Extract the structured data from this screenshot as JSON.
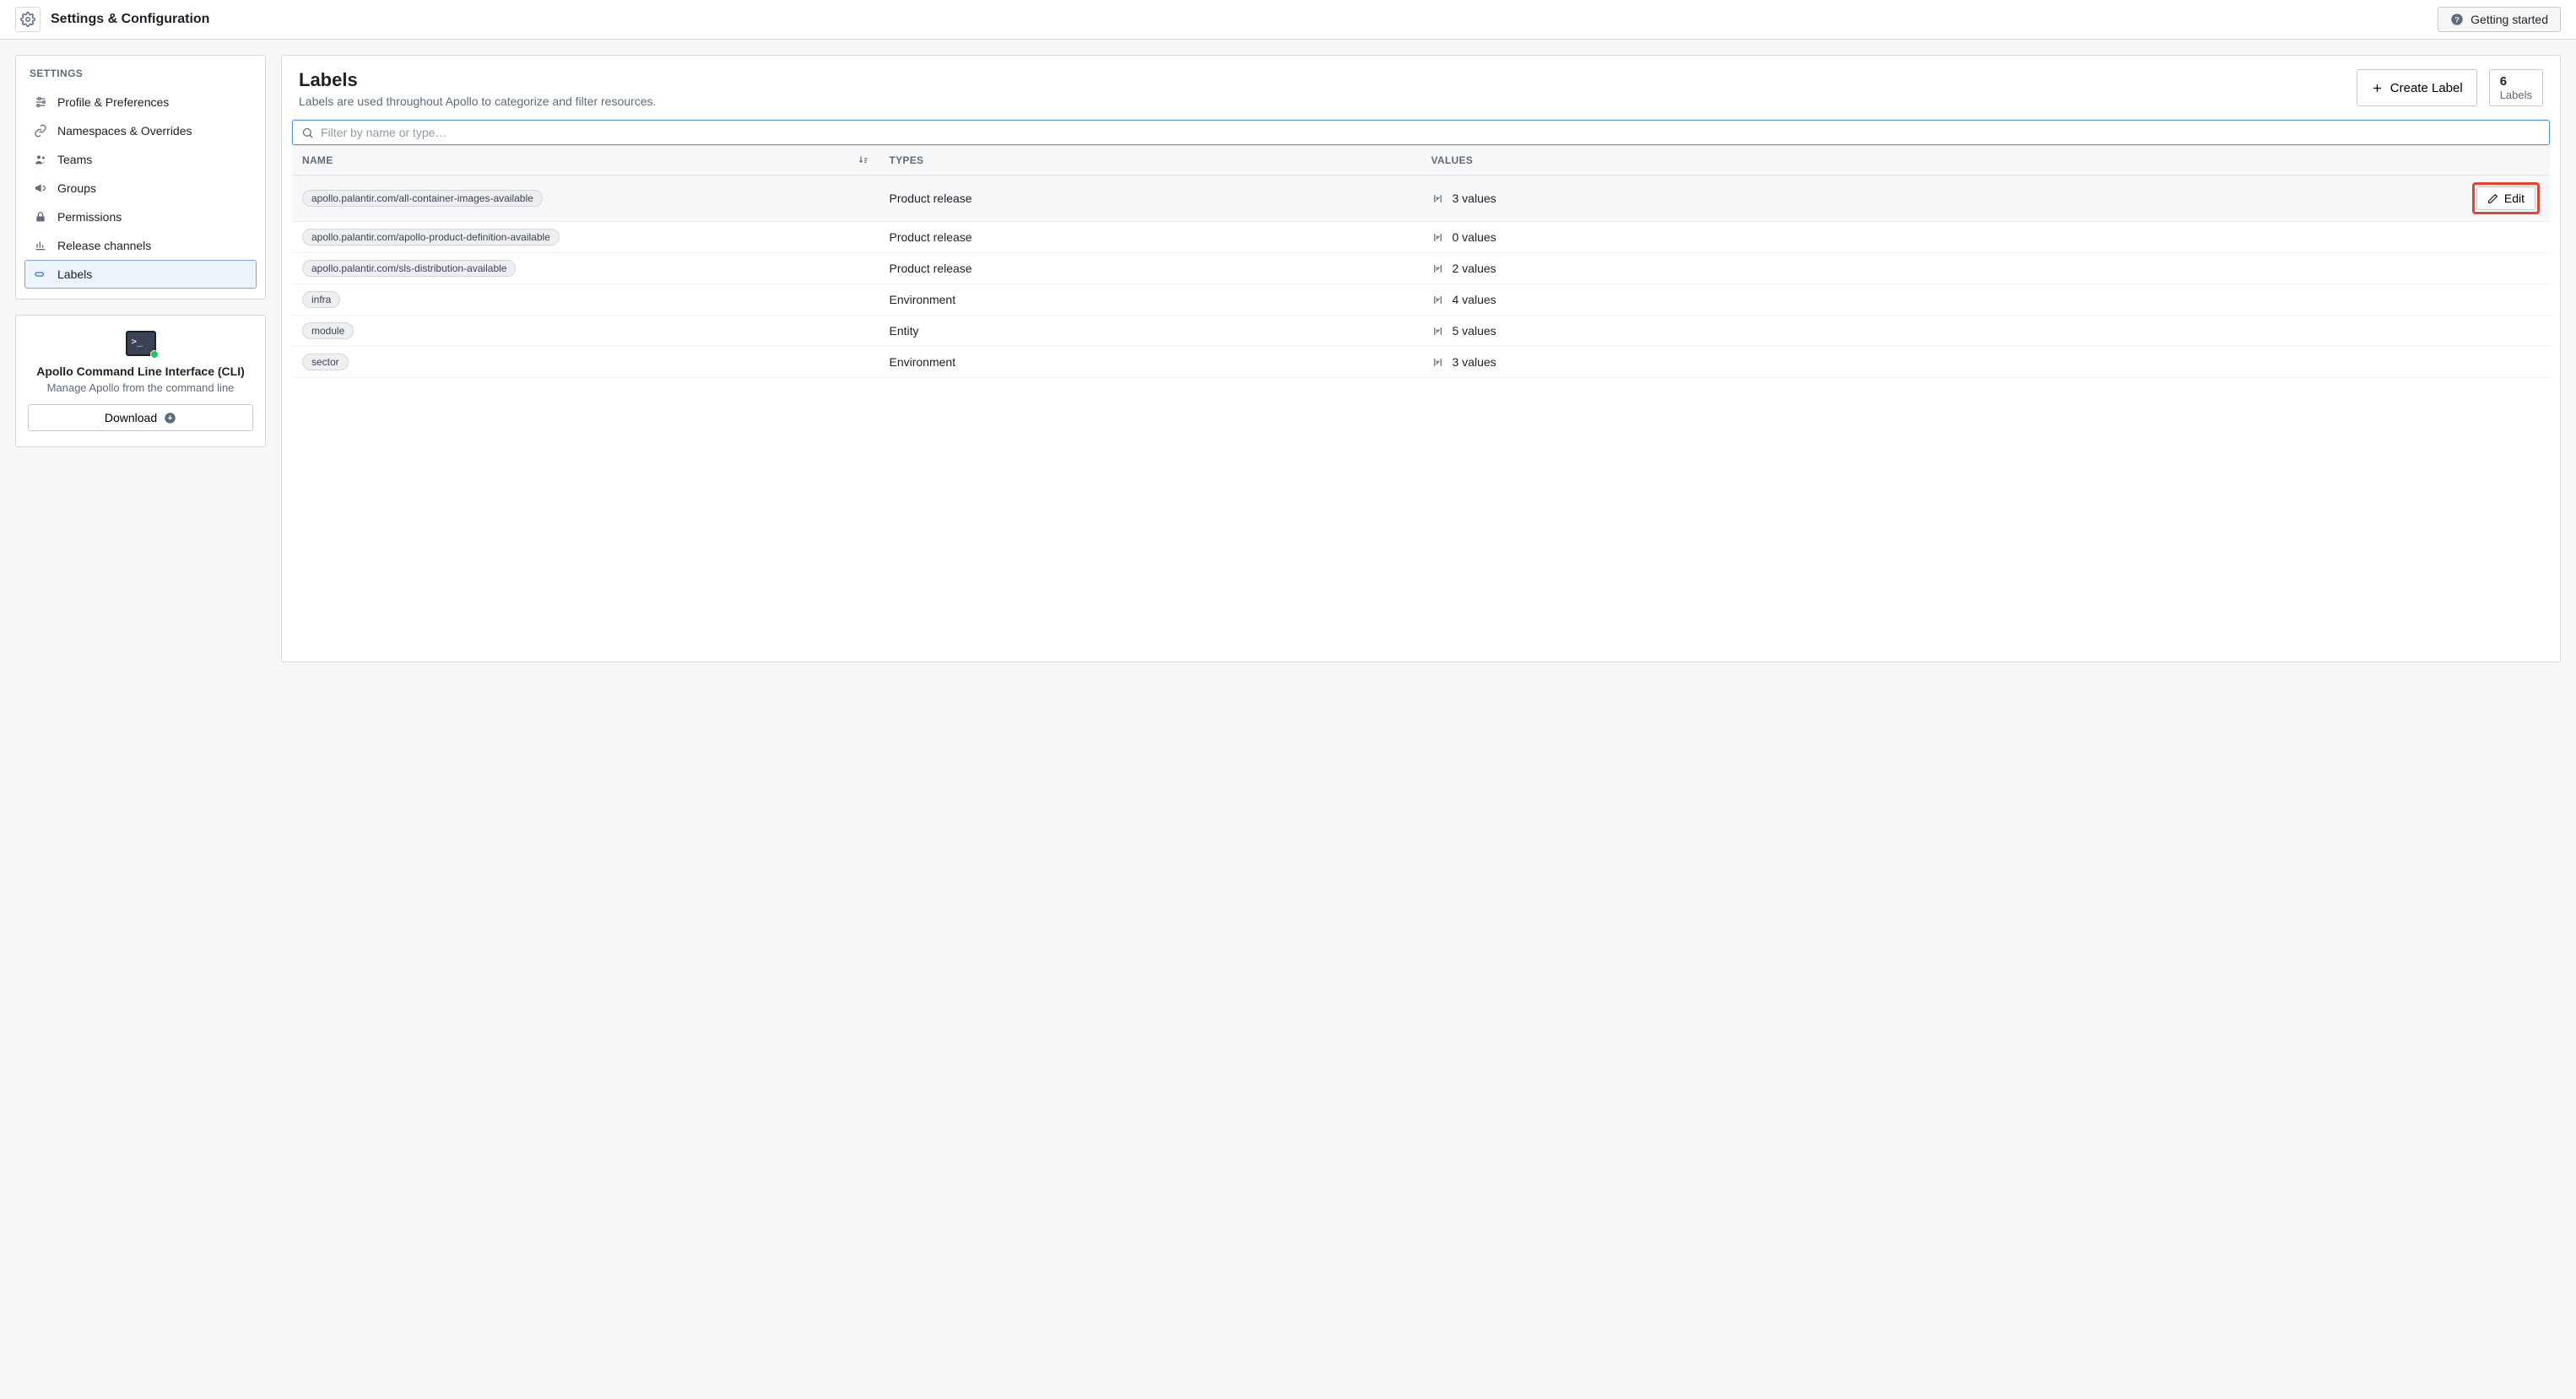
{
  "header": {
    "title": "Settings & Configuration",
    "getting_started": "Getting started"
  },
  "sidebar": {
    "heading": "SETTINGS",
    "items": [
      {
        "label": "Profile & Preferences",
        "icon": "sliders"
      },
      {
        "label": "Namespaces & Overrides",
        "icon": "link"
      },
      {
        "label": "Teams",
        "icon": "people"
      },
      {
        "label": "Groups",
        "icon": "megaphone"
      },
      {
        "label": "Permissions",
        "icon": "lock"
      },
      {
        "label": "Release channels",
        "icon": "chart"
      },
      {
        "label": "Labels",
        "icon": "label"
      }
    ],
    "active_index": 6
  },
  "cli": {
    "title": "Apollo Command Line Interface (CLI)",
    "subtitle": "Manage Apollo from the command line",
    "download": "Download"
  },
  "main": {
    "title": "Labels",
    "description": "Labels are used throughout Apollo to categorize and filter resources.",
    "create_label": "Create Label",
    "count_number": "6",
    "count_label": "Labels",
    "filter_placeholder": "Filter by name or type…",
    "columns": {
      "name": "NAME",
      "types": "TYPES",
      "values": "VALUES"
    },
    "edit_label": "Edit",
    "rows": [
      {
        "name": "apollo.palantir.com/all-container-images-available",
        "type": "Product release",
        "values": "3 values",
        "hovered": true,
        "show_edit": true
      },
      {
        "name": "apollo.palantir.com/apollo-product-definition-available",
        "type": "Product release",
        "values": "0 values"
      },
      {
        "name": "apollo.palantir.com/sls-distribution-available",
        "type": "Product release",
        "values": "2 values"
      },
      {
        "name": "infra",
        "type": "Environment",
        "values": "4 values"
      },
      {
        "name": "module",
        "type": "Entity",
        "values": "5 values"
      },
      {
        "name": "sector",
        "type": "Environment",
        "values": "3 values"
      }
    ]
  }
}
